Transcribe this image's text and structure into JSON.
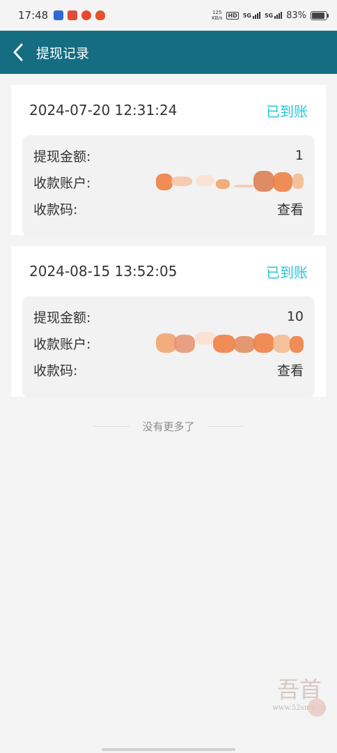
{
  "status_bar": {
    "time": "17:48",
    "net_speed_value": "125",
    "net_speed_unit": "KB/s",
    "hd_label": "HD",
    "net1_label": "5G",
    "net2_label": "5G",
    "battery_percent": "83%",
    "battery_level": 0.83,
    "app_icon_colors": [
      "#2d6ad6",
      "#e24a3a",
      "#e8462d",
      "#e4552a"
    ]
  },
  "header": {
    "back_icon": "chevron-left-icon",
    "title": "提现记录",
    "color": "#156d82"
  },
  "records": [
    {
      "datetime": "2024-07-20 12:31:24",
      "status": "已到账",
      "amount_label": "提现金额:",
      "amount": "1",
      "account_label": "收款账户:",
      "code_label": "收款码:",
      "code_action": "查看"
    },
    {
      "datetime": "2024-08-15 13:52:05",
      "status": "已到账",
      "amount_label": "提现金额:",
      "amount": "10",
      "account_label": "收款账户:",
      "code_label": "收款码:",
      "code_action": "查看"
    }
  ],
  "footer": {
    "no_more": "没有更多了"
  },
  "watermark": {
    "chars": "吾爱首码",
    "url": "www.52smw.cn"
  },
  "colors": {
    "status": "#21c8d9",
    "background": "#f4f4f4",
    "redaction": "#f07a3a"
  }
}
